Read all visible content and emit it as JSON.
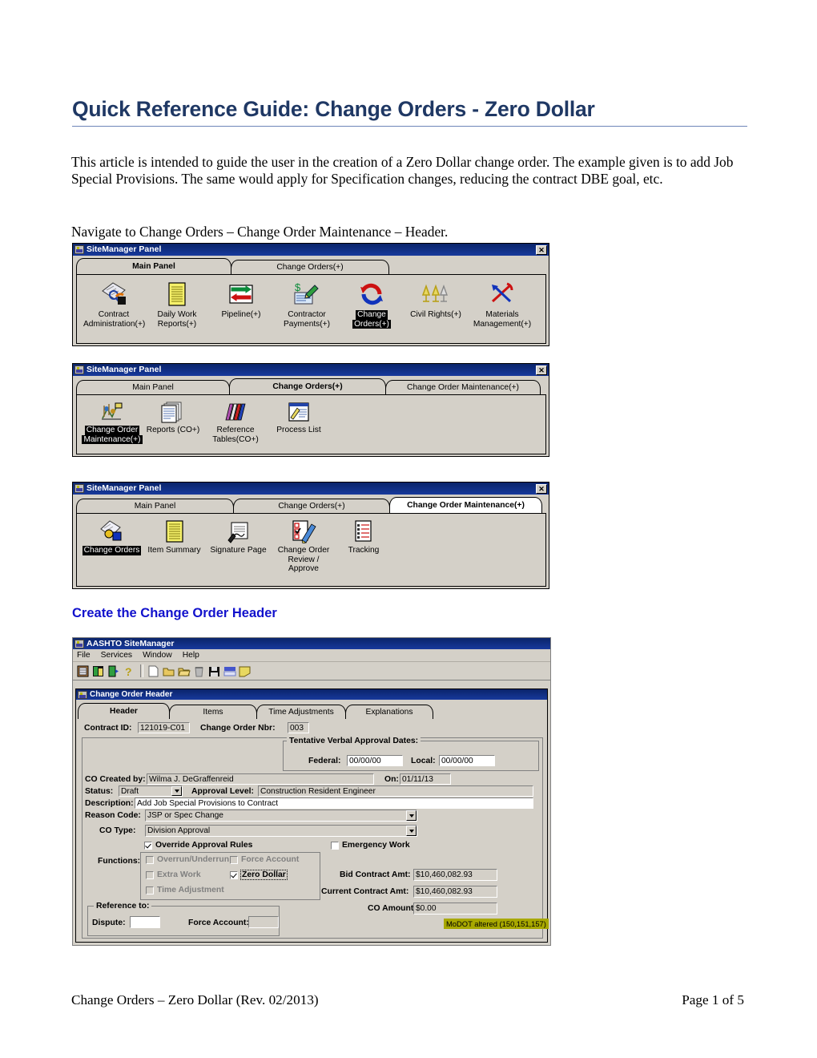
{
  "document": {
    "title": "Quick Reference Guide: Change Orders - Zero Dollar",
    "intro_paragraph": "This article is intended to guide the user in the creation of a Zero Dollar change order.   The example given is to add Job Special Provisions.  The same would apply for Specification changes, reducing the contract DBE goal, etc.",
    "navigate_line": "Navigate to Change Orders – Change Order Maintenance – Header.",
    "section_heading": "Create the Change Order Header",
    "footer_left": "Change Orders – Zero Dollar (Rev. 02/2013)",
    "footer_right": "Page 1 of 5",
    "title_color": "#1F3864",
    "heading_color": "#1111CC"
  },
  "panel1": {
    "window_title": "SiteManager Panel",
    "close_label": "✕",
    "tabs": [
      {
        "label": "Main Panel",
        "active": true
      },
      {
        "label": "Change Orders(+)",
        "active": false
      }
    ],
    "icons": [
      {
        "label": "Contract\nAdministration(+)",
        "line1": "Contract",
        "line2": "Administration(+)",
        "icon": "contract-administration-icon",
        "selected": false
      },
      {
        "label": "Daily Work\nReports(+)",
        "line1": "Daily Work",
        "line2": "Reports(+)",
        "icon": "daily-work-reports-icon",
        "selected": false
      },
      {
        "label": "Pipeline(+)",
        "line1": "Pipeline(+)",
        "line2": "",
        "icon": "pipeline-icon",
        "selected": false
      },
      {
        "label": "Contractor\nPayments(+)",
        "line1": "Contractor",
        "line2": "Payments(+)",
        "icon": "contractor-payments-icon",
        "selected": false
      },
      {
        "label": "Change\nOrders(+)",
        "line1": "Change",
        "line2": "Orders(+)",
        "icon": "change-orders-icon",
        "selected": true
      },
      {
        "label": "Civil Rights(+)",
        "line1": "Civil Rights(+)",
        "line2": "",
        "icon": "civil-rights-icon",
        "selected": false
      },
      {
        "label": "Materials\nManagement(+)",
        "line1": "Materials",
        "line2": "Management(+)",
        "icon": "materials-management-icon",
        "selected": false
      }
    ]
  },
  "panel2": {
    "window_title": "SiteManager Panel",
    "close_label": "✕",
    "tabs": [
      {
        "label": "Main Panel",
        "active": false
      },
      {
        "label": "Change Orders(+)",
        "active": true
      },
      {
        "label": "Change Order Maintenance(+)",
        "active": false
      }
    ],
    "icons": [
      {
        "line1": "Change Order",
        "line2": "Maintenance(+)",
        "icon": "change-order-maintenance-icon",
        "selected": true
      },
      {
        "line1": "Reports (CO+)",
        "line2": "",
        "icon": "reports-co-icon",
        "selected": false
      },
      {
        "line1": "Reference",
        "line2": "Tables(CO+)",
        "icon": "reference-tables-icon",
        "selected": false
      },
      {
        "line1": "Process List",
        "line2": "",
        "icon": "process-list-icon",
        "selected": false
      }
    ]
  },
  "panel3": {
    "window_title": "SiteManager Panel",
    "close_label": "✕",
    "tabs": [
      {
        "label": "Main Panel",
        "active": false
      },
      {
        "label": "Change Orders(+)",
        "active": false
      },
      {
        "label": "Change Order Maintenance(+)",
        "active": true
      }
    ],
    "icons": [
      {
        "line1": "Change Orders",
        "line2": "",
        "line3": "",
        "icon": "change-orders-icon",
        "selected": true
      },
      {
        "line1": "Item Summary",
        "line2": "",
        "line3": "",
        "icon": "item-summary-icon",
        "selected": false
      },
      {
        "line1": "Signature Page",
        "line2": "",
        "line3": "",
        "icon": "signature-page-icon",
        "selected": false
      },
      {
        "line1": "Change Order",
        "line2": "Review /",
        "line3": "Approve",
        "icon": "change-order-review-approve-icon",
        "selected": false
      },
      {
        "line1": "Tracking",
        "line2": "",
        "line3": "",
        "icon": "tracking-icon",
        "selected": false
      }
    ]
  },
  "app": {
    "window_title": "AASHTO SiteManager",
    "menu": [
      "File",
      "Services",
      "Window",
      "Help"
    ],
    "toolbar_icons": [
      "panel-icon",
      "services-icon",
      "logout-icon",
      "help-icon",
      "new-icon",
      "open-icon",
      "open-alt-icon",
      "delete-icon",
      "save-icon",
      "milestone-icon",
      "notes-icon"
    ],
    "inner_window_title": "Change Order Header",
    "tabs": [
      {
        "label": "Header",
        "active": true
      },
      {
        "label": "Items",
        "active": false
      },
      {
        "label": "Time Adjustments",
        "active": false
      },
      {
        "label": "Explanations",
        "active": false
      }
    ],
    "form": {
      "contract_id_label": "Contract ID:",
      "contract_id_value": "121019-C01",
      "change_order_nbr_label": "Change Order Nbr:",
      "change_order_nbr_value": "003",
      "tentative_group_title": "Tentative Verbal Approval Dates:",
      "federal_label": "Federal:",
      "federal_value": "00/00/00",
      "local_label": "Local:",
      "local_value": "00/00/00",
      "co_created_by_label": "CO Created by:",
      "co_created_by_value": "Wilma J. DeGraffenreid",
      "on_label": "On:",
      "on_value": "01/11/13",
      "status_label": "Status:",
      "status_value": "Draft",
      "approval_level_label": "Approval Level:",
      "approval_level_value": "Construction Resident Engineer",
      "description_label": "Description:",
      "description_value": "Add Job Special Provisions to Contract",
      "reason_code_label": "Reason Code:",
      "reason_code_value": "JSP or Spec Change",
      "co_type_label": "CO Type:",
      "co_type_value": "Division Approval",
      "override_approval_rules_label": "Override Approval Rules",
      "override_approval_rules_checked": true,
      "emergency_work_label": "Emergency Work",
      "emergency_work_checked": false,
      "functions_label": "Functions:",
      "functions": [
        {
          "label": "Overrun/Underrun",
          "checked": false,
          "disabled": true
        },
        {
          "label": "Force Account",
          "checked": false,
          "disabled": true
        },
        {
          "label": "Extra Work",
          "checked": false,
          "disabled": true
        },
        {
          "label": "Zero Dollar",
          "checked": true,
          "disabled": false
        },
        {
          "label": "Time Adjustment",
          "checked": false,
          "disabled": true
        }
      ],
      "reference_to_title": "Reference to:",
      "dispute_label": "Dispute:",
      "dispute_value": "",
      "force_account_label": "Force Account:",
      "force_account_value": "",
      "bid_contract_amt_label": "Bid Contract Amt:",
      "bid_contract_amt_value": "$10,460,082.93",
      "current_contract_amt_label": "Current Contract Amt:",
      "current_contract_amt_value": "$10,460,082.93",
      "co_amount_label": "CO Amount:",
      "co_amount_value": "$0.00",
      "altered_badge": "MoDOT altered (150,151,157)",
      "altered_badge_color": "#a8a800"
    }
  }
}
